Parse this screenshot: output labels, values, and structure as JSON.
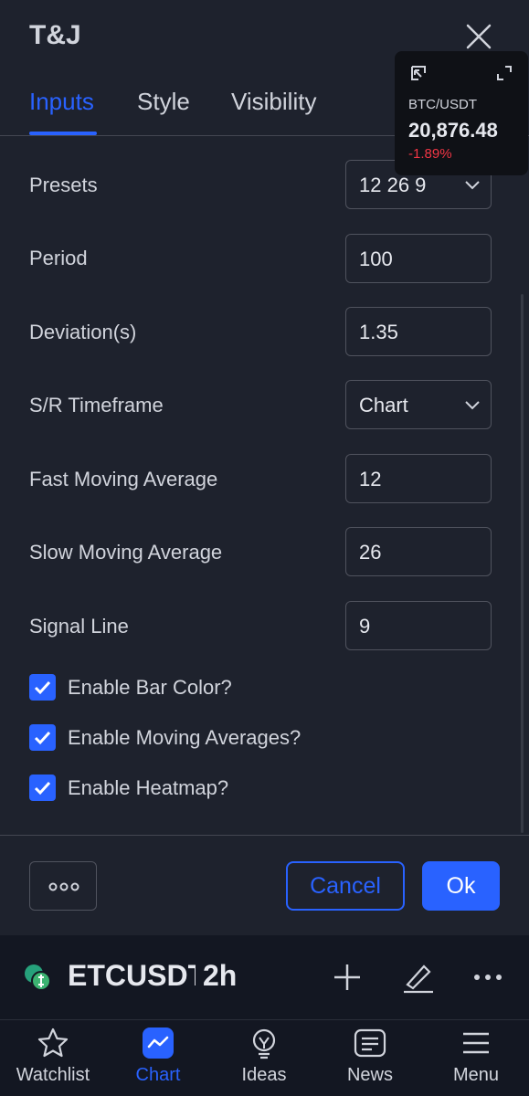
{
  "dialog": {
    "title": "T&J",
    "tabs": [
      {
        "label": "Inputs",
        "active": true
      },
      {
        "label": "Style",
        "active": false
      },
      {
        "label": "Visibility",
        "active": false
      }
    ]
  },
  "ticker": {
    "symbol": "BTC/USDT",
    "price": "20,876.48",
    "change": "-1.89%",
    "change_color": "#f23645"
  },
  "inputs": [
    {
      "label": "Presets",
      "value": "12 26 9",
      "type": "select"
    },
    {
      "label": "Period",
      "value": "100",
      "type": "number"
    },
    {
      "label": "Deviation(s)",
      "value": "1.35",
      "type": "number"
    },
    {
      "label": "S/R Timeframe",
      "value": "Chart",
      "type": "select"
    },
    {
      "label": "Fast Moving Average",
      "value": "12",
      "type": "number"
    },
    {
      "label": "Slow Moving Average",
      "value": "26",
      "type": "number"
    },
    {
      "label": "Signal Line",
      "value": "9",
      "type": "number"
    }
  ],
  "checkboxes": [
    {
      "label": "Enable Bar Color?",
      "checked": true
    },
    {
      "label": "Enable Moving Averages?",
      "checked": true
    },
    {
      "label": "Enable Heatmap?",
      "checked": true
    }
  ],
  "footer": {
    "more_icon": "ellipsis-icon",
    "cancel_label": "Cancel",
    "ok_label": "Ok"
  },
  "symbol_bar": {
    "symbol": "ETCUSDT",
    "timeframe": "2h",
    "icons": [
      "plus-icon",
      "draw-pen-icon",
      "more-dots-icon"
    ]
  },
  "nav": [
    {
      "label": "Watchlist",
      "icon": "star-icon",
      "active": false
    },
    {
      "label": "Chart",
      "icon": "chart-icon",
      "active": true
    },
    {
      "label": "Ideas",
      "icon": "lightbulb-icon",
      "active": false
    },
    {
      "label": "News",
      "icon": "news-icon",
      "active": false
    },
    {
      "label": "Menu",
      "icon": "menu-icon",
      "active": false
    }
  ],
  "colors": {
    "accent": "#2962ff",
    "background": "#1e222d",
    "negative": "#f23645"
  }
}
